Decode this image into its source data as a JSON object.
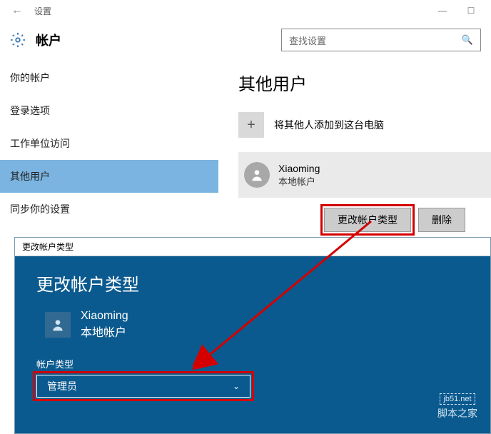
{
  "titlebar": {
    "back": "←",
    "title": "设置",
    "min": "—",
    "max": "☐"
  },
  "header": {
    "account": "帐户"
  },
  "search": {
    "placeholder": "查找设置"
  },
  "sidebar": {
    "items": [
      {
        "label": "你的帐户"
      },
      {
        "label": "登录选项"
      },
      {
        "label": "工作单位访问"
      },
      {
        "label": "其他用户"
      },
      {
        "label": "同步你的设置"
      }
    ]
  },
  "content": {
    "heading": "其他用户",
    "add_label": "将其他人添加到这台电脑",
    "user": {
      "name": "Xiaoming",
      "type": "本地帐户"
    },
    "change_btn": "更改帐户类型",
    "delete_btn": "删除"
  },
  "dialog": {
    "window_title": "更改帐户类型",
    "heading": "更改帐户类型",
    "user": {
      "name": "Xiaoming",
      "type": "本地帐户"
    },
    "field_label": "帐户类型",
    "selected": "管理员"
  },
  "watermark": {
    "url": "jb51.net",
    "text": "脚本之家"
  }
}
